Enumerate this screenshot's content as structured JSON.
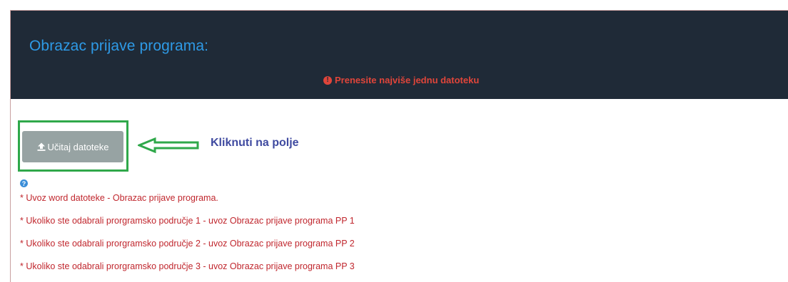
{
  "header": {
    "title": "Obrazac prijave programa:",
    "alert": "Prenesite najviše jednu datoteku",
    "alert_icon": "exclamation-circle-icon"
  },
  "upload": {
    "label": "Učitaj datoteke",
    "icon": "upload-icon"
  },
  "annotation": {
    "instruction": "Kliknuti na polje",
    "highlight_color": "#2fa84a",
    "arrow_direction": "left"
  },
  "help": {
    "icon": "question-circle-icon"
  },
  "notes": [
    "* Uvoz word datoteke - Obrazac prijave programa.",
    "* Ukoliko ste odabrali prorgramsko područje 1 - uvoz Obrazac prijave programa PP 1",
    "* Ukoliko ste odabrali prorgramsko područje 2 - uvoz Obrazac prijave programa PP 2",
    "* Ukoliko ste odabrali prorgramsko područje 3 - uvoz Obrazac prijave programa PP 3"
  ],
  "colors": {
    "header_bg": "#1f2a37",
    "title": "#2e9ae6",
    "alert": "#e0453a",
    "button_bg": "#97a3a3",
    "note_text": "#c0262d"
  }
}
